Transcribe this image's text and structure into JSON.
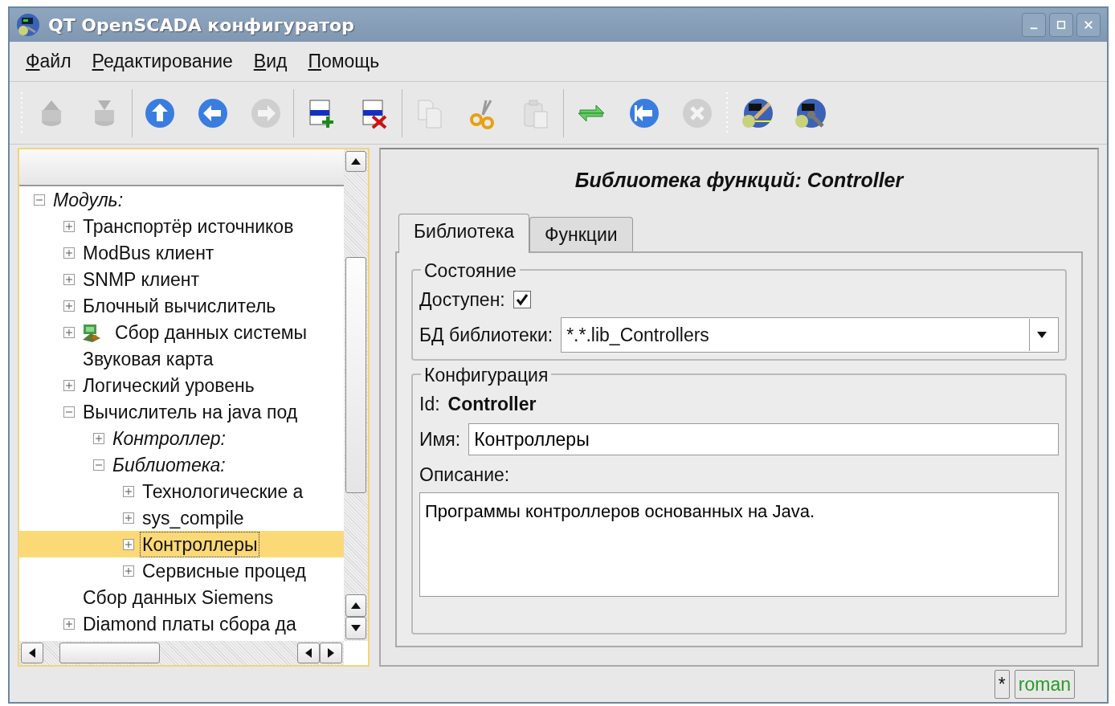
{
  "window": {
    "title": "QT OpenSCADA конфигуратор"
  },
  "menu": [
    {
      "label": "Файл"
    },
    {
      "label": "Редактирование"
    },
    {
      "label": "Вид"
    },
    {
      "label": "Помощь"
    }
  ],
  "toolbar": [
    [
      {
        "kind": "db-load",
        "disabled": true
      },
      {
        "kind": "db-save",
        "disabled": true
      }
    ],
    [
      {
        "kind": "up",
        "disabled": false
      },
      {
        "kind": "back",
        "disabled": false
      },
      {
        "kind": "forward",
        "disabled": true
      }
    ],
    [
      {
        "kind": "add",
        "disabled": false
      },
      {
        "kind": "delete",
        "disabled": false
      }
    ],
    [
      {
        "kind": "copy",
        "disabled": true
      },
      {
        "kind": "cut",
        "disabled": false
      },
      {
        "kind": "paste",
        "disabled": true
      }
    ],
    [
      {
        "kind": "refresh",
        "disabled": false
      },
      {
        "kind": "start",
        "disabled": false
      },
      {
        "kind": "stop",
        "disabled": true
      }
    ],
    [
      {
        "kind": "edit-panel",
        "disabled": false
      },
      {
        "kind": "config-panel",
        "disabled": false
      }
    ]
  ],
  "tree": [
    {
      "label": "Модуль:",
      "kind": "group",
      "expanded": true,
      "selected": false,
      "children": [
        {
          "label": "Транспортёр источников",
          "kind": "item",
          "expanded": false,
          "selected": false
        },
        {
          "label": "ModBus клиент",
          "kind": "item",
          "expanded": false,
          "selected": false
        },
        {
          "label": "SNMP клиент",
          "kind": "item",
          "expanded": false,
          "selected": false
        },
        {
          "label": "Блочный вычислитель",
          "kind": "item",
          "expanded": false,
          "selected": false
        },
        {
          "label": "Сбор данных системы",
          "kind": "item",
          "expanded": false,
          "selected": false,
          "has_icon": true
        },
        {
          "label": "Звуковая карта",
          "kind": "item",
          "selected": false
        },
        {
          "label": "Логический уровень",
          "kind": "item",
          "expanded": false,
          "selected": false
        },
        {
          "label": "Вычислитель на java под",
          "kind": "item",
          "expanded": true,
          "selected": false,
          "children": [
            {
              "label": "Контроллер:",
              "kind": "group",
              "expanded": false,
              "selected": false
            },
            {
              "label": "Библиотека:",
              "kind": "group",
              "expanded": true,
              "selected": false,
              "children": [
                {
                  "label": "Технологические а",
                  "kind": "item",
                  "expanded": false,
                  "selected": false
                },
                {
                  "label": "sys_compile",
                  "kind": "item",
                  "expanded": false,
                  "selected": false
                },
                {
                  "label": "Контроллеры",
                  "kind": "item",
                  "expanded": false,
                  "selected": true
                },
                {
                  "label": "Сервисные процед",
                  "kind": "item",
                  "expanded": false,
                  "selected": false
                }
              ]
            }
          ]
        },
        {
          "label": "Сбор данных Siemens",
          "kind": "item",
          "selected": false
        },
        {
          "label": "Diamond платы сбора да",
          "kind": "item",
          "expanded": false,
          "selected": false
        }
      ]
    }
  ],
  "page": {
    "title": "Библиотека функций: Controller",
    "tabs": [
      {
        "label": "Библиотека",
        "selected": true
      },
      {
        "label": "Функции",
        "selected": false
      }
    ],
    "state_group": {
      "title": "Состояние",
      "enabled_label": "Доступен:",
      "enabled": true,
      "db_label": "БД библиотеки:",
      "db_value": "*.*.lib_Controllers"
    },
    "config_group": {
      "title": "Конфигурация",
      "id_label": "Id:",
      "id_value": "Controller",
      "name_label": "Имя:",
      "name_value": "Контроллеры",
      "description_label": "Описание:",
      "description_value": "Программы контроллеров основанных на Java."
    }
  },
  "status_bar": {
    "modified": "*",
    "user": "roman"
  }
}
